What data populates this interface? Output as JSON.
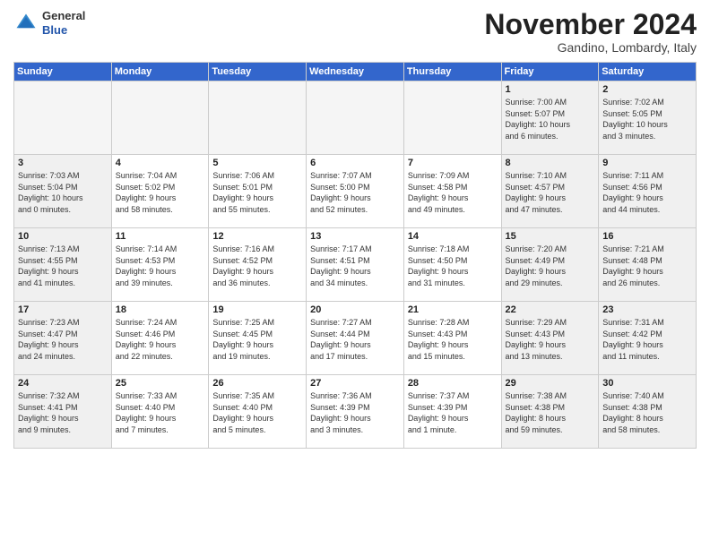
{
  "header": {
    "month_title": "November 2024",
    "location": "Gandino, Lombardy, Italy",
    "logo_general": "General",
    "logo_blue": "Blue"
  },
  "days_of_week": [
    "Sunday",
    "Monday",
    "Tuesday",
    "Wednesday",
    "Thursday",
    "Friday",
    "Saturday"
  ],
  "weeks": [
    [
      {
        "day": "",
        "info": "",
        "empty": true
      },
      {
        "day": "",
        "info": "",
        "empty": true
      },
      {
        "day": "",
        "info": "",
        "empty": true
      },
      {
        "day": "",
        "info": "",
        "empty": true
      },
      {
        "day": "",
        "info": "",
        "empty": true
      },
      {
        "day": "1",
        "info": "Sunrise: 7:00 AM\nSunset: 5:07 PM\nDaylight: 10 hours\nand 6 minutes.",
        "weekend": true
      },
      {
        "day": "2",
        "info": "Sunrise: 7:02 AM\nSunset: 5:05 PM\nDaylight: 10 hours\nand 3 minutes.",
        "weekend": true
      }
    ],
    [
      {
        "day": "3",
        "info": "Sunrise: 7:03 AM\nSunset: 5:04 PM\nDaylight: 10 hours\nand 0 minutes.",
        "weekend": true
      },
      {
        "day": "4",
        "info": "Sunrise: 7:04 AM\nSunset: 5:02 PM\nDaylight: 9 hours\nand 58 minutes."
      },
      {
        "day": "5",
        "info": "Sunrise: 7:06 AM\nSunset: 5:01 PM\nDaylight: 9 hours\nand 55 minutes."
      },
      {
        "day": "6",
        "info": "Sunrise: 7:07 AM\nSunset: 5:00 PM\nDaylight: 9 hours\nand 52 minutes."
      },
      {
        "day": "7",
        "info": "Sunrise: 7:09 AM\nSunset: 4:58 PM\nDaylight: 9 hours\nand 49 minutes."
      },
      {
        "day": "8",
        "info": "Sunrise: 7:10 AM\nSunset: 4:57 PM\nDaylight: 9 hours\nand 47 minutes.",
        "weekend": true
      },
      {
        "day": "9",
        "info": "Sunrise: 7:11 AM\nSunset: 4:56 PM\nDaylight: 9 hours\nand 44 minutes.",
        "weekend": true
      }
    ],
    [
      {
        "day": "10",
        "info": "Sunrise: 7:13 AM\nSunset: 4:55 PM\nDaylight: 9 hours\nand 41 minutes.",
        "weekend": true
      },
      {
        "day": "11",
        "info": "Sunrise: 7:14 AM\nSunset: 4:53 PM\nDaylight: 9 hours\nand 39 minutes."
      },
      {
        "day": "12",
        "info": "Sunrise: 7:16 AM\nSunset: 4:52 PM\nDaylight: 9 hours\nand 36 minutes."
      },
      {
        "day": "13",
        "info": "Sunrise: 7:17 AM\nSunset: 4:51 PM\nDaylight: 9 hours\nand 34 minutes."
      },
      {
        "day": "14",
        "info": "Sunrise: 7:18 AM\nSunset: 4:50 PM\nDaylight: 9 hours\nand 31 minutes."
      },
      {
        "day": "15",
        "info": "Sunrise: 7:20 AM\nSunset: 4:49 PM\nDaylight: 9 hours\nand 29 minutes.",
        "weekend": true
      },
      {
        "day": "16",
        "info": "Sunrise: 7:21 AM\nSunset: 4:48 PM\nDaylight: 9 hours\nand 26 minutes.",
        "weekend": true
      }
    ],
    [
      {
        "day": "17",
        "info": "Sunrise: 7:23 AM\nSunset: 4:47 PM\nDaylight: 9 hours\nand 24 minutes.",
        "weekend": true
      },
      {
        "day": "18",
        "info": "Sunrise: 7:24 AM\nSunset: 4:46 PM\nDaylight: 9 hours\nand 22 minutes."
      },
      {
        "day": "19",
        "info": "Sunrise: 7:25 AM\nSunset: 4:45 PM\nDaylight: 9 hours\nand 19 minutes."
      },
      {
        "day": "20",
        "info": "Sunrise: 7:27 AM\nSunset: 4:44 PM\nDaylight: 9 hours\nand 17 minutes."
      },
      {
        "day": "21",
        "info": "Sunrise: 7:28 AM\nSunset: 4:43 PM\nDaylight: 9 hours\nand 15 minutes."
      },
      {
        "day": "22",
        "info": "Sunrise: 7:29 AM\nSunset: 4:43 PM\nDaylight: 9 hours\nand 13 minutes.",
        "weekend": true
      },
      {
        "day": "23",
        "info": "Sunrise: 7:31 AM\nSunset: 4:42 PM\nDaylight: 9 hours\nand 11 minutes.",
        "weekend": true
      }
    ],
    [
      {
        "day": "24",
        "info": "Sunrise: 7:32 AM\nSunset: 4:41 PM\nDaylight: 9 hours\nand 9 minutes.",
        "weekend": true
      },
      {
        "day": "25",
        "info": "Sunrise: 7:33 AM\nSunset: 4:40 PM\nDaylight: 9 hours\nand 7 minutes."
      },
      {
        "day": "26",
        "info": "Sunrise: 7:35 AM\nSunset: 4:40 PM\nDaylight: 9 hours\nand 5 minutes."
      },
      {
        "day": "27",
        "info": "Sunrise: 7:36 AM\nSunset: 4:39 PM\nDaylight: 9 hours\nand 3 minutes."
      },
      {
        "day": "28",
        "info": "Sunrise: 7:37 AM\nSunset: 4:39 PM\nDaylight: 9 hours\nand 1 minute."
      },
      {
        "day": "29",
        "info": "Sunrise: 7:38 AM\nSunset: 4:38 PM\nDaylight: 8 hours\nand 59 minutes.",
        "weekend": true
      },
      {
        "day": "30",
        "info": "Sunrise: 7:40 AM\nSunset: 4:38 PM\nDaylight: 8 hours\nand 58 minutes.",
        "weekend": true
      }
    ]
  ]
}
